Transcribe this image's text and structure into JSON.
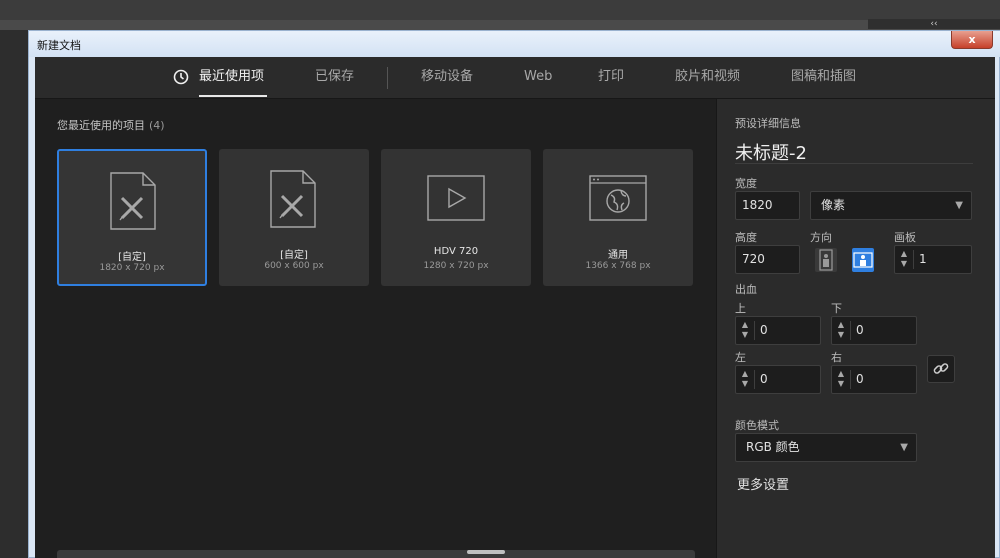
{
  "app": {
    "collapse_arrows": "‹‹"
  },
  "dialog": {
    "title": "新建文档",
    "close_label": "x"
  },
  "tabs": [
    {
      "label": "最近使用项",
      "active": true
    },
    {
      "label": "已保存"
    },
    {
      "label": "移动设备"
    },
    {
      "label": "Web"
    },
    {
      "label": "打印"
    },
    {
      "label": "胶片和视频"
    },
    {
      "label": "图稿和插图"
    }
  ],
  "recent": {
    "title": "您最近使用的项目",
    "count": "(4)",
    "items": [
      {
        "name": "[自定]",
        "size": "1820 x 720 px",
        "icon": "document-pencil-icon",
        "selected": true
      },
      {
        "name": "[自定]",
        "size": "600 x 600 px",
        "icon": "document-pencil-icon"
      },
      {
        "name": "HDV 720",
        "size": "1280 x 720 px",
        "icon": "video-play-icon"
      },
      {
        "name": "通用",
        "size": "1366 x 768 px",
        "icon": "web-globe-icon"
      }
    ]
  },
  "preset": {
    "section_title": "预设详细信息",
    "doc_name": "未标题-2",
    "width_label": "宽度",
    "width_value": "1820",
    "unit_value": "像素",
    "height_label": "高度",
    "height_value": "720",
    "orientation_label": "方向",
    "artboard_label": "画板",
    "artboard_value": "1",
    "bleed_label": "出血",
    "top_label": "上",
    "top_value": "0",
    "bottom_label": "下",
    "bottom_value": "0",
    "left_label": "左",
    "left_value": "0",
    "right_label": "右",
    "right_value": "0",
    "color_mode_label": "颜色模式",
    "color_mode_value": "RGB 颜色",
    "more_settings": "更多设置"
  },
  "colors": {
    "accent": "#2f7fe0",
    "panel": "#2b2b2b",
    "background": "#1f1f1f"
  }
}
